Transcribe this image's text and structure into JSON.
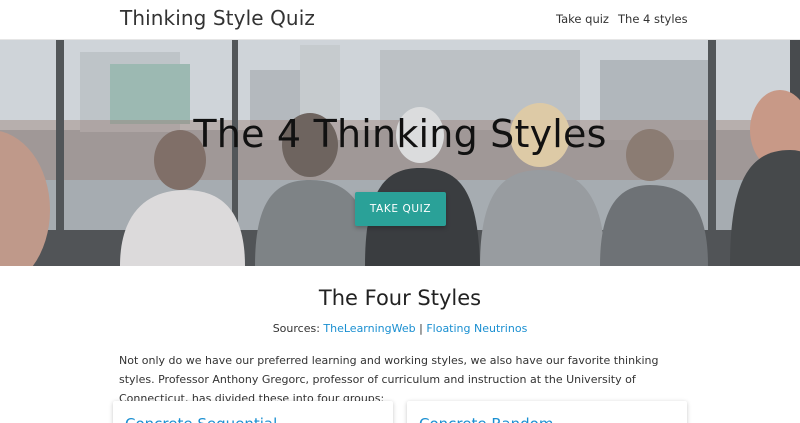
{
  "navbar": {
    "brand": "Thinking Style Quiz",
    "links": [
      "Take quiz",
      "The 4 styles"
    ]
  },
  "hero": {
    "title": "The 4 Thinking Styles",
    "button_label": "TAKE QUIZ"
  },
  "content": {
    "section_title": "The Four Styles",
    "sources_label": "Sources:",
    "source_links": [
      "TheLearningWeb",
      "Floating Neutrinos"
    ],
    "sources_separator": "|",
    "intro": "Not only do we have our preferred learning and working styles, we also have our favorite thinking styles. Professor Anthony Gregorc, professor of curriculum and instruction at the University of Connecticut, has divided these into four groups:",
    "cards": [
      "Concrete Sequential",
      "Concrete Random"
    ]
  },
  "colors": {
    "accent": "#2aa198",
    "link": "#1a8fd1"
  }
}
